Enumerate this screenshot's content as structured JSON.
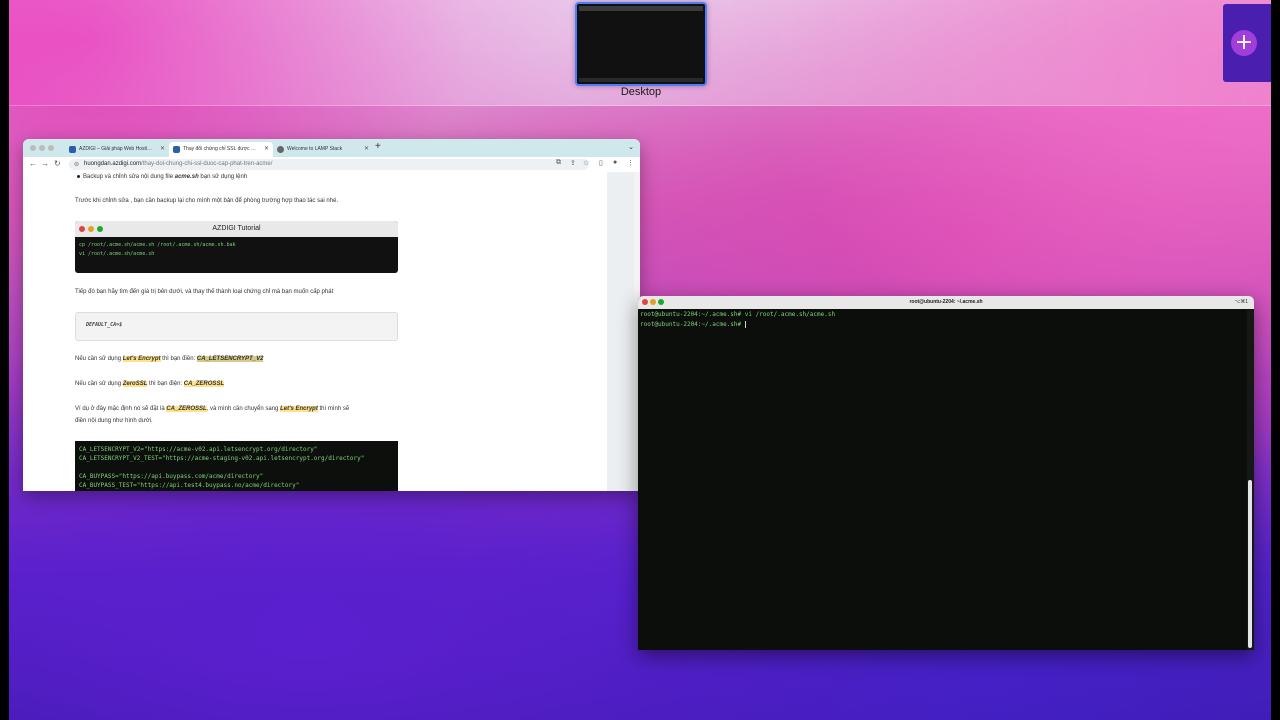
{
  "mission_control": {
    "desktop_label": "Desktop",
    "add_space_icon": "plus-icon"
  },
  "browser": {
    "tabs": [
      {
        "label": "AZDIGI – Giải pháp Web Hosti…",
        "active": false
      },
      {
        "label": "Thay đổi chứng chỉ SSL được …",
        "active": true
      },
      {
        "label": "Welcome to LAMP Stack",
        "active": false
      }
    ],
    "url_host": "huongdan.azdigi.com",
    "url_path": "/thay-doi-chung-chi-ssl-duoc-cap-phat-tren-acme/",
    "article": {
      "bullet_prefix": "Backup và chỉnh sửa nội dung file ",
      "bullet_file": "acme.sh",
      "bullet_suffix": " bạn sử dụng lệnh",
      "p1": "Trước khi chỉnh sửa , bạn cần backup lại cho mình một bản để phòng trường hợp thao tác sai nhé.",
      "code_title": "AZDIGI Tutorial",
      "code_lines": [
        "cp /root/.acme.sh/acme.sh /root/.acme.sh/acme.sh.bak",
        "vi /root/.acme.sh/acme.sh"
      ],
      "p2": "Tiếp đó bạn hãy tìm đến giá trị bên dưới, và thay thế thành loại chứng chỉ mà bạn muốn cấp phát",
      "default_var": "DEFAULT_CA=$",
      "le_prefix": "Nếu cần sử dụng ",
      "le_name": "Let's Encrypt",
      "le_mid": " thì bạn điền: ",
      "le_value": "CA_LETSENCRYPT_V2",
      "zs_prefix": "Nếu cần sử dụng ",
      "zs_name": "ZeroSSL",
      "zs_mid": " thì bạn điện: ",
      "zs_value": "CA_ZEROSSL",
      "p3_a": "Ví dụ ở đây mặc định nó sẽ đặt là ",
      "p3_b": "CA_ZEROSSL",
      "p3_c": ", và mình cần chuyển sang ",
      "p3_d": "Let's Encrypt",
      "p3_e": " thì mình sẽ",
      "p3_line2": "điền nội dung như hình dưới.",
      "code2_lines": [
        "CA_LETSENCRYPT_V2=\"https://acme-v02.api.letsencrypt.org/directory\"",
        "CA_LETSENCRYPT_V2_TEST=\"https://acme-staging-v02.api.letsencrypt.org/directory\"",
        "",
        "CA_BUYPASS=\"https://api.buypass.com/acme/directory\"",
        "CA_BUYPASS_TEST=\"https://api.test4.buypass.no/acme/directory\""
      ]
    }
  },
  "terminal": {
    "title": "root@ubuntu-2204: ~/.acme.sh",
    "shortcut": "⌥⌘1",
    "lines": [
      "root@ubuntu-2204:~/.acme.sh# vi /root/.acme.sh/acme.sh",
      "root@ubuntu-2204:~/.acme.sh# "
    ]
  },
  "colors": {
    "terminal_text": "#7fd27a",
    "highlight": "#fde28a",
    "selected_space_border": "#4d7dff"
  }
}
